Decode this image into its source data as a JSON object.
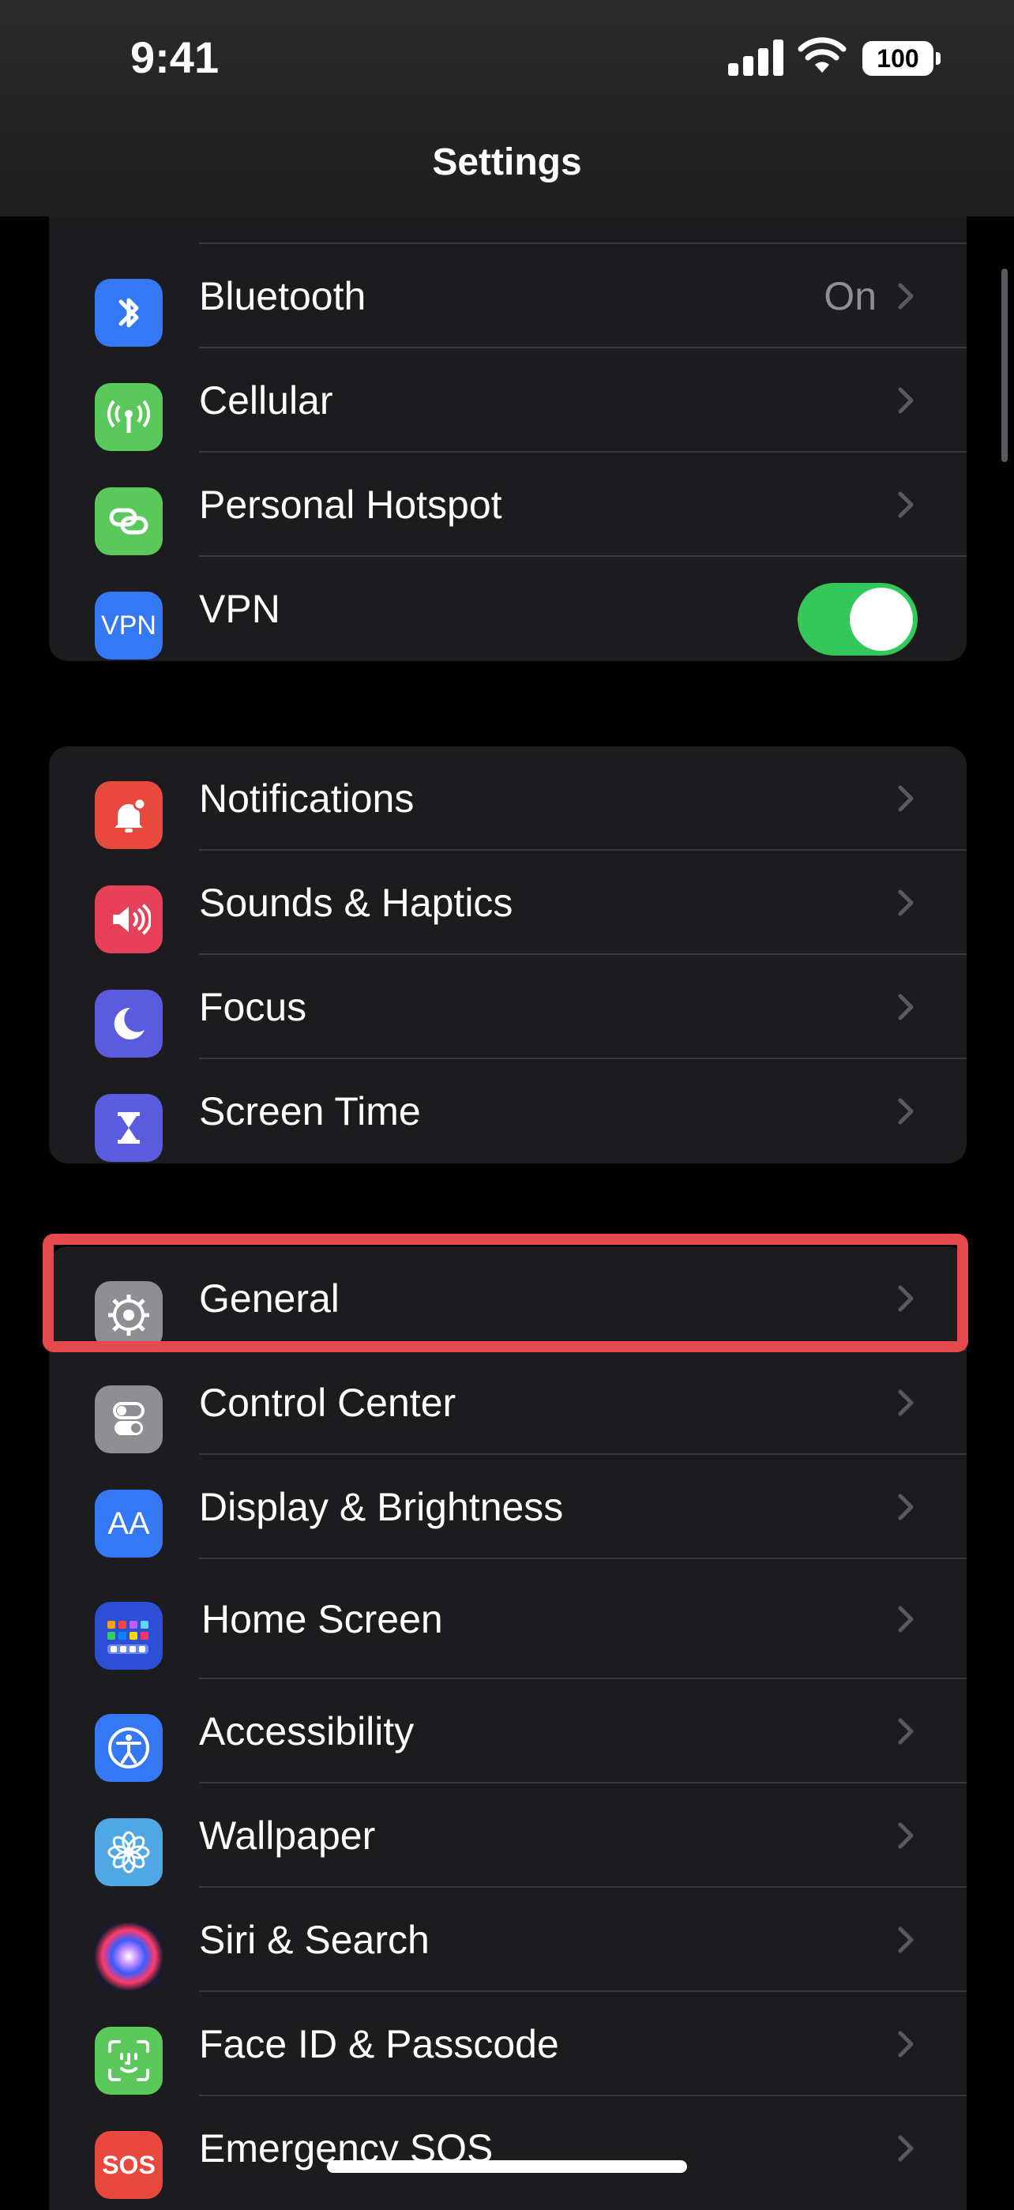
{
  "status": {
    "time": "9:41",
    "battery": "100"
  },
  "nav": {
    "title": "Settings"
  },
  "groups": [
    {
      "rows": [
        {
          "label": "Bluetooth",
          "value": "On",
          "icon": "bluetooth-icon",
          "color": "#3478f6"
        },
        {
          "label": "Cellular",
          "icon": "antenna-icon",
          "color": "#5ac85a"
        },
        {
          "label": "Personal Hotspot",
          "icon": "hotspot-icon",
          "color": "#5ac85a"
        },
        {
          "label": "VPN",
          "icon": "vpn-icon",
          "color": "#3478f6",
          "toggle": true
        }
      ]
    },
    {
      "rows": [
        {
          "label": "Notifications",
          "icon": "bell-icon",
          "color": "#e8483d"
        },
        {
          "label": "Sounds & Haptics",
          "icon": "speaker-icon",
          "color": "#e84058"
        },
        {
          "label": "Focus",
          "icon": "moon-icon",
          "color": "#5b5be0"
        },
        {
          "label": "Screen Time",
          "icon": "hourglass-icon",
          "color": "#5b5be0"
        }
      ]
    },
    {
      "rows": [
        {
          "label": "General",
          "icon": "gear-icon",
          "color": "#8e8e93"
        },
        {
          "label": "Control Center",
          "icon": "switches-icon",
          "color": "#8e8e93"
        },
        {
          "label": "Display & Brightness",
          "icon": "text-size-icon",
          "color": "#3478f6"
        },
        {
          "label": "Home Screen",
          "icon": "app-grid-icon",
          "color": "#2c4fd6"
        },
        {
          "label": "Accessibility",
          "icon": "accessibility-icon",
          "color": "#3478f6"
        },
        {
          "label": "Wallpaper",
          "icon": "flower-icon",
          "color": "#4fa8e3"
        },
        {
          "label": "Siri & Search",
          "icon": "siri-icon",
          "color": "#1a1a2e"
        },
        {
          "label": "Face ID & Passcode",
          "icon": "face-id-icon",
          "color": "#5ac85a"
        },
        {
          "label": "Emergency SOS",
          "icon": "sos-icon",
          "color": "#e8483d"
        }
      ]
    }
  ],
  "icon_text": {
    "vpn": "VPN",
    "display": "AA",
    "sos": "SOS"
  }
}
